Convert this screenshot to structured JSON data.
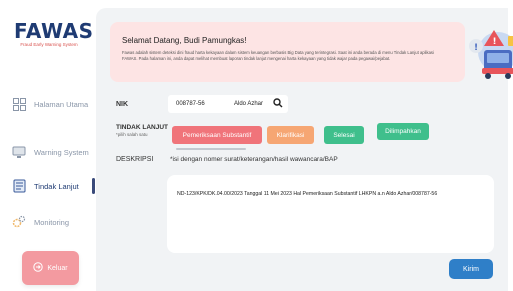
{
  "sidebar": {
    "logo": {
      "name": "FAWAS",
      "tagline": "Fraud Early Warning System"
    },
    "items": [
      {
        "label": "Halaman Utama",
        "icon": "grid-icon"
      },
      {
        "label": "Warning System",
        "icon": "monitor-icon"
      },
      {
        "label": "Tindak Lanjut",
        "icon": "document-list-icon",
        "active": true
      },
      {
        "label": "Monitoring",
        "icon": "gear-cluster-icon"
      }
    ],
    "logout_label": "Keluar"
  },
  "banner": {
    "title": "Selamat Datang, Budi Pamungkas!",
    "description": "Fawas adalah sistem deteksi dini fraud harta kekayaan dalam sistem keuangan berbasis Big Data yang terintegrasi. Saat ini anda berada di menu Tindak Lanjut aplikasi FAWAS. Pada halaman ini, anda dapat melihat membuat laporan tindak lanjut mengenai harta kekayaan yang tidak wajar pada pegawai/pejabat."
  },
  "form": {
    "nik_label": "NIK",
    "nik_value": "008787-56",
    "nik_name": "Aldo Azhar",
    "tindak_label": "TINDAK LANJUT",
    "tindak_sublabel": "*pilih salah satu",
    "options": [
      "Pemeriksaan Substantif",
      "Klarifikasi",
      "Selesai",
      "Dilimpahkan"
    ],
    "deskripsi_label": "DESKRIPSI",
    "deskripsi_hint": "*isi dengan nomer surat/keterangan/hasil wawancara/BAP",
    "deskripsi_value": "ND-123/KPK/DK.04.00/2023 Tanggal 11 Mei 2023 Hal Pemeriksaan Substantif LHKPN a.n Aldo Azhar/008787-56",
    "submit_label": "Kirim"
  },
  "colors": {
    "brand": "#1f3b73",
    "banner_bg": "#fde4e4",
    "pill_red": "#f0747a",
    "pill_orange": "#f6a673",
    "pill_green": "#3fbf8c",
    "submit": "#2f7fc8",
    "logout": "#f39aa0"
  }
}
